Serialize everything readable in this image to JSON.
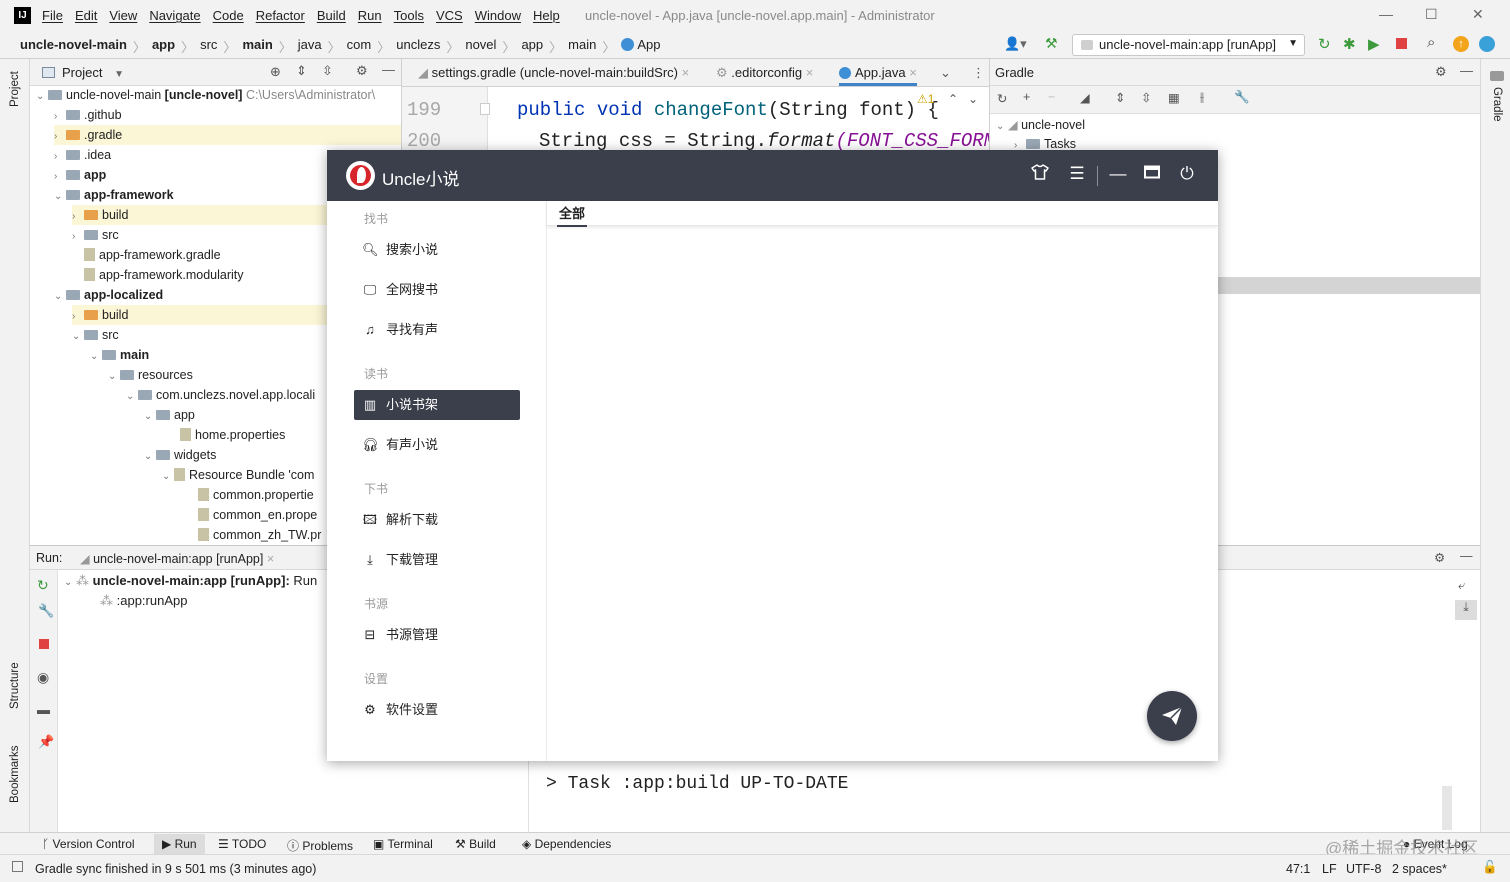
{
  "ide": {
    "window_title": "uncle-novel - App.java [uncle-novel.app.main] - Administrator",
    "menu": [
      "File",
      "Edit",
      "View",
      "Navigate",
      "Code",
      "Refactor",
      "Build",
      "Run",
      "Tools",
      "VCS",
      "Window",
      "Help"
    ],
    "breadcrumbs": [
      "uncle-novel-main",
      "app",
      "src",
      "main",
      "java",
      "com",
      "unclezs",
      "novel",
      "app",
      "main",
      "App"
    ],
    "run_config": "uncle-novel-main:app [runApp]",
    "left_tabs": [
      "Project",
      "Structure",
      "Bookmarks"
    ],
    "right_tabs": [
      "Gradle"
    ],
    "project": {
      "title": "Project",
      "root_name": "uncle-novel-main",
      "root_module": "[uncle-novel]",
      "root_path": "C:\\Users\\Administrator\\",
      "items": [
        {
          "label": "github",
          "prefix": "."
        },
        {
          "label": "gradle",
          "prefix": "."
        },
        {
          "label": "idea",
          "prefix": "."
        },
        {
          "label": "app"
        },
        {
          "label": "app-framework"
        },
        {
          "label": "build"
        },
        {
          "label": "src"
        },
        {
          "label": "app-framework.gradle"
        },
        {
          "label": "app-framework.modularity"
        },
        {
          "label": "app-localized"
        },
        {
          "label": "build"
        },
        {
          "label": "src"
        },
        {
          "label": "main"
        },
        {
          "label": "resources"
        },
        {
          "label": "com.unclezs.novel.app.locali"
        },
        {
          "label": "app"
        },
        {
          "label": "home.properties"
        },
        {
          "label": "widgets"
        },
        {
          "label": "Resource Bundle 'com"
        },
        {
          "label": "common.propertie"
        },
        {
          "label": "common_en.prope"
        },
        {
          "label": "common_zh_TW.pr"
        }
      ]
    },
    "editor_tabs": [
      "settings.gradle (uncle-novel-main:buildSrc)",
      ".editorconfig",
      "App.java"
    ],
    "editor": {
      "lines": [
        {
          "num": "199",
          "code_keyword": "public void ",
          "code_method": "changeFont",
          "code_rest": "(String font) {"
        },
        {
          "num": "200",
          "code_keyword": "",
          "code_method": "",
          "code_rest": "String css = String.",
          "code_italic": "format",
          "code_const": "(FONT_CSS_FORMA"
        }
      ],
      "warning_count": "1"
    },
    "gradle": {
      "title": "Gradle",
      "root": "uncle-novel",
      "child": "Tasks"
    },
    "run": {
      "label": "Run:",
      "tab": "uncle-novel-main:app [runApp]",
      "task_bold": "uncle-novel-main:app [runApp]:",
      "task_rest": "Run",
      "subtask": ":app:runApp",
      "console_line": "> Task :app:build UP-TO-DATE"
    },
    "bottom_tools": [
      "Version Control",
      "Run",
      "TODO",
      "Problems",
      "Terminal",
      "Build",
      "Dependencies"
    ],
    "event_log": "Event Log",
    "status": {
      "message": "Gradle sync finished in 9 s 501 ms (3 minutes ago)",
      "position": "47:1",
      "line_sep": "LF",
      "encoding": "UTF-8",
      "indent": "2 spaces*"
    },
    "watermark": "@稀土掘金技术社区"
  },
  "app": {
    "title": "Uncle小说",
    "sections": [
      {
        "label": "找书",
        "items": [
          "搜索小说",
          "全网搜书",
          "寻找有声"
        ]
      },
      {
        "label": "读书",
        "items": [
          "小说书架",
          "有声小说"
        ]
      },
      {
        "label": "下书",
        "items": [
          "解析下载",
          "下载管理"
        ]
      },
      {
        "label": "书源",
        "items": [
          "书源管理"
        ]
      },
      {
        "label": "设置",
        "items": [
          "软件设置"
        ]
      }
    ],
    "active_item": "小说书架",
    "tabs": [
      "全部"
    ],
    "icons": {
      "theme": "tshirt-icon",
      "menu": "hamburger-icon",
      "minimize": "minimize-icon",
      "maximize": "maximize-icon",
      "power": "power-icon",
      "fab": "paper-plane-icon"
    },
    "colors": {
      "titlebar": "#3b3f4b",
      "active": "#3b3f4b",
      "logo_red": "#d7262b"
    }
  }
}
